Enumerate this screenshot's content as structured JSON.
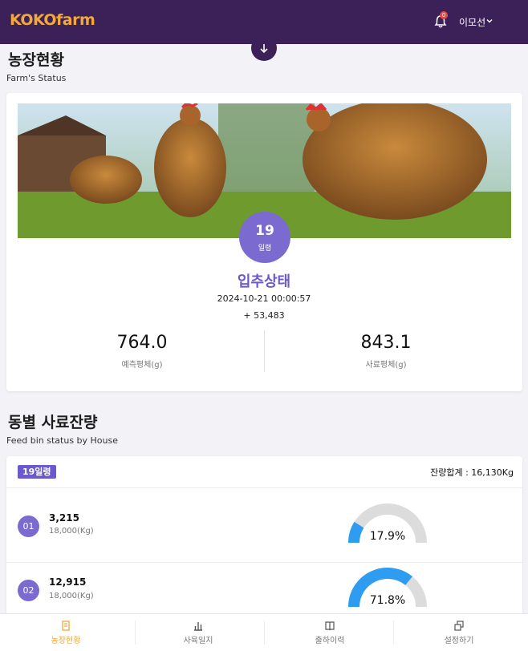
{
  "app": {
    "logo": "KOKOfarm",
    "notification_count": "0",
    "user_name": "이모선"
  },
  "farm_status": {
    "title": "농장현황",
    "subtitle": "Farm's Status",
    "age_value": "19",
    "age_unit": "일령",
    "status_title": "입추상태",
    "datetime": "2024-10-21 00:00:57",
    "count": "+ 53,483",
    "stats": [
      {
        "value": "764.0",
        "label": "예측평체(g)"
      },
      {
        "value": "843.1",
        "label": "사료평체(g)"
      }
    ]
  },
  "feed_bin": {
    "title": "동별 사료잔량",
    "subtitle": "Feed bin status by House",
    "age_badge": "19일령",
    "total_label": "잔량합계 : 16,130Kg",
    "bins": [
      {
        "number": "01",
        "value": "3,215",
        "capacity": "18,000(Kg)",
        "percent_label": "17.9%",
        "percent": 17.9
      },
      {
        "number": "02",
        "value": "12,915",
        "capacity": "18,000(Kg)",
        "percent_label": "71.8%",
        "percent": 71.8
      }
    ]
  },
  "tabs": [
    {
      "label": "농장현황",
      "icon": "farm-status-icon",
      "active": true
    },
    {
      "label": "사육일지",
      "icon": "bar-chart-icon",
      "active": false
    },
    {
      "label": "출하이력",
      "icon": "book-icon",
      "active": false
    },
    {
      "label": "설정하기",
      "icon": "copy-icon",
      "active": false
    }
  ],
  "colors": {
    "header": "#3c2159",
    "accent": "#6a5acd",
    "active_tab": "#f2a83a",
    "gauge_fill": "#2e9cf0",
    "gauge_track": "#dcdcdc"
  }
}
